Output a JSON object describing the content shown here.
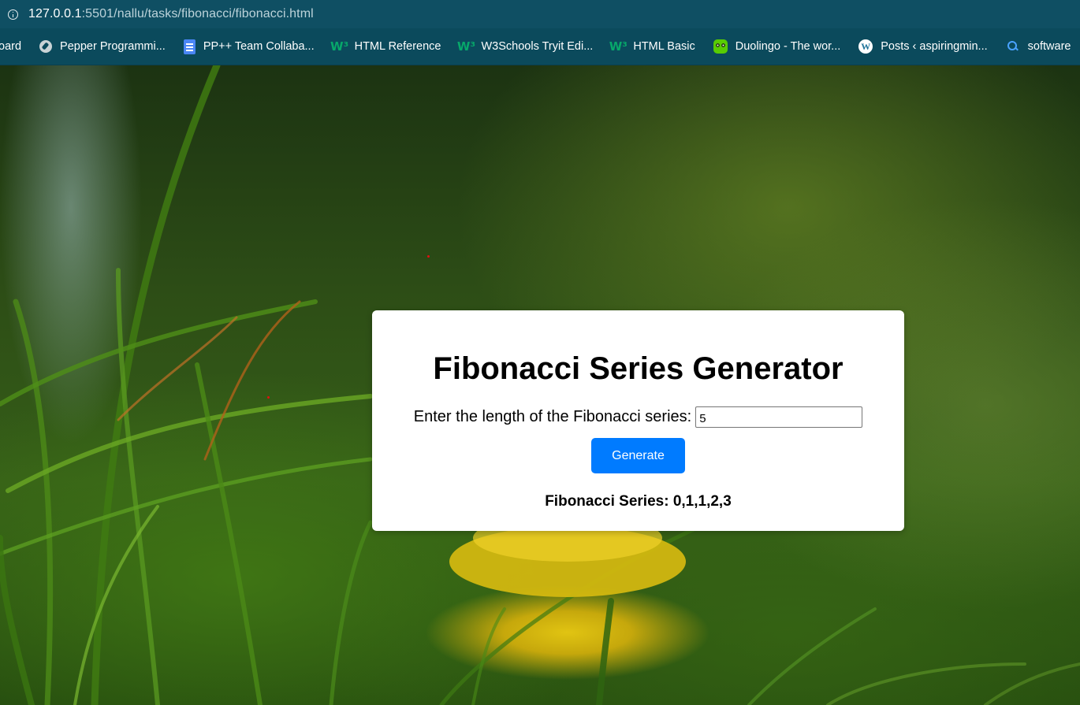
{
  "browser": {
    "url_host": "127.0.0.1",
    "url_rest": ":5501/nallu/tasks/fibonacci/fibonacci.html"
  },
  "bookmarks": [
    {
      "label": "oard",
      "icon": "none"
    },
    {
      "label": "Pepper Programmi...",
      "icon": "compass-icon"
    },
    {
      "label": "PP++ Team Collaba...",
      "icon": "google-docs-icon"
    },
    {
      "label": "HTML Reference",
      "icon": "w3schools-icon"
    },
    {
      "label": "W3Schools Tryit Edi...",
      "icon": "w3schools-icon"
    },
    {
      "label": "HTML Basic",
      "icon": "w3schools-icon"
    },
    {
      "label": "Duolingo - The wor...",
      "icon": "duolingo-icon"
    },
    {
      "label": "Posts ‹ aspiringmin...",
      "icon": "wordpress-icon"
    },
    {
      "label": "software",
      "icon": "search-icon"
    }
  ],
  "app": {
    "title": "Fibonacci Series Generator",
    "input_label": "Enter the length of the Fibonacci series:",
    "input_value": "5",
    "button_label": "Generate",
    "result_text": "Fibonacci Series: 0,1,1,2,3"
  },
  "colors": {
    "button": "#007bff",
    "card": "#ffffff",
    "addressbar": "#0f4f63"
  }
}
